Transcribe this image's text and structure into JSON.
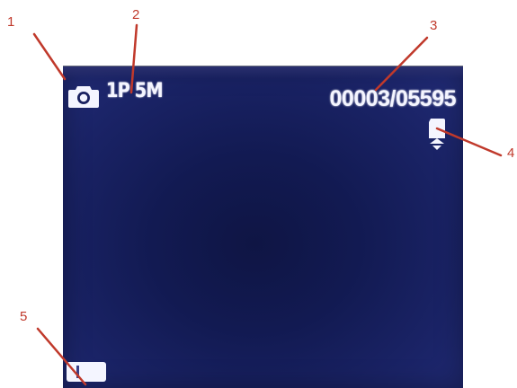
{
  "screen": {
    "mode_icon": "camera-icon",
    "resolution": "1P 5M",
    "counter": "00003/05595",
    "storage_icon": "memory-card-icon",
    "battery_icon": "battery-icon"
  },
  "callouts": [
    {
      "number": "1",
      "points_to": "camera-icon"
    },
    {
      "number": "2",
      "points_to": "resolution"
    },
    {
      "number": "3",
      "points_to": "counter"
    },
    {
      "number": "4",
      "points_to": "memory-card-icon"
    },
    {
      "number": "5",
      "points_to": "battery-icon"
    }
  ],
  "colors": {
    "screen_background": "#141c55",
    "screen_text": "#f4f5ff",
    "callout": "#c0392b"
  }
}
